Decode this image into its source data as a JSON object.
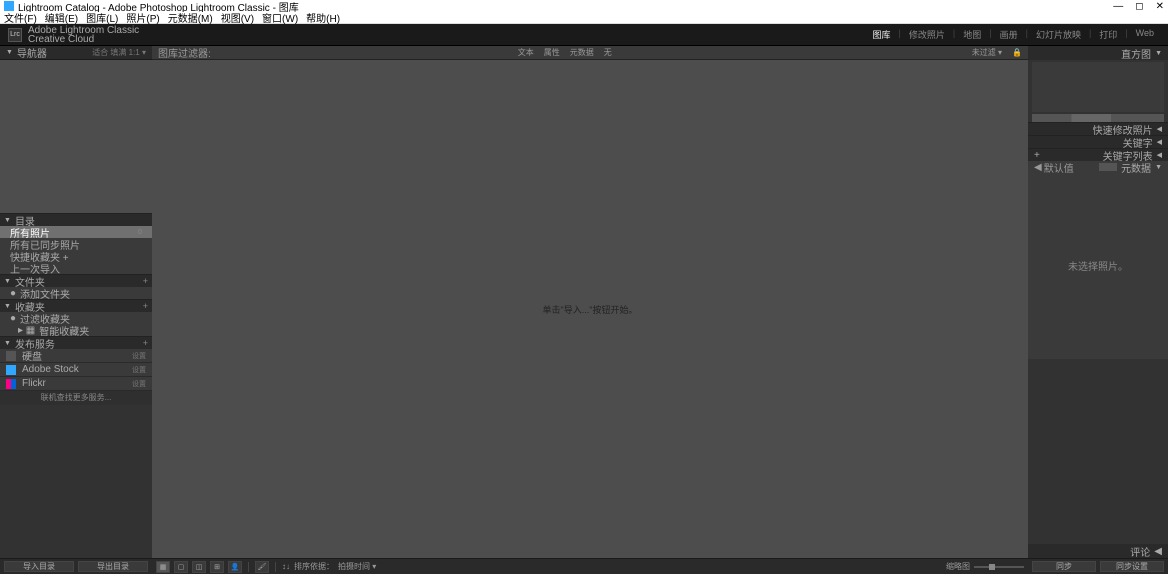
{
  "window": {
    "title": "Lightroom Catalog - Adobe Photoshop Lightroom Classic - 图库"
  },
  "menu": {
    "items": [
      "文件(F)",
      "编辑(E)",
      "图库(L)",
      "照片(P)",
      "元数据(M)",
      "视图(V)",
      "窗口(W)",
      "帮助(H)"
    ]
  },
  "brand": {
    "line1": "Adobe Lightroom Classic",
    "line2": "Creative Cloud"
  },
  "modules": {
    "items": [
      "图库",
      "修改照片",
      "地图",
      "画册",
      "幻灯片放映",
      "打印",
      "Web"
    ],
    "active": 0
  },
  "leftpanel": {
    "navigator": {
      "title": "导航器",
      "opts": "适合  填满  1:1  ▾"
    },
    "catalog": {
      "title": "目录",
      "items": [
        {
          "label": "所有照片",
          "count": "0",
          "selected": true
        },
        {
          "label": "所有已同步照片",
          "count": ""
        },
        {
          "label": "快捷收藏夹  +",
          "count": ""
        },
        {
          "label": "上一次导入",
          "count": ""
        }
      ]
    },
    "folders": {
      "title": "文件夹",
      "item": "添加文件夹"
    },
    "collections": {
      "title": "收藏夹",
      "items": [
        {
          "label": "过滤收藏夹",
          "sub": false
        },
        {
          "label": "智能收藏夹",
          "sub": true,
          "icon": "▸"
        }
      ]
    },
    "publish": {
      "title": "发布服务",
      "items": [
        {
          "label": "硬盘",
          "setup": "设置",
          "icon": "disk"
        },
        {
          "label": "Adobe Stock",
          "setup": "设置",
          "icon": "stock"
        },
        {
          "label": "Flickr",
          "setup": "设置",
          "icon": "flickr"
        }
      ],
      "find": "联机查找更多服务..."
    },
    "buttons": {
      "import": "导入目录",
      "export": "导出目录"
    }
  },
  "filterbar": {
    "left": "图库过滤器:",
    "items": [
      "文本",
      "属性",
      "元数据",
      "无"
    ],
    "rightlabel": "未过滤 ▾",
    "lock": "🔒"
  },
  "content": {
    "text": "单击\"导入...\"按钮开始。"
  },
  "toolbar": {
    "sort": "排序依据：",
    "thumbs": "缩略图"
  },
  "rightpanel": {
    "histogram": "直方图",
    "sections": {
      "quickdev": "快速修改照片",
      "keywords": "关键字",
      "keywordlist": "关键字列表",
      "metadata": "元数据",
      "preset": "默认值"
    },
    "meta_empty": "未选择照片。",
    "comments": "评论",
    "buttons": {
      "sync": "同步",
      "syncset": "同步设置"
    }
  }
}
